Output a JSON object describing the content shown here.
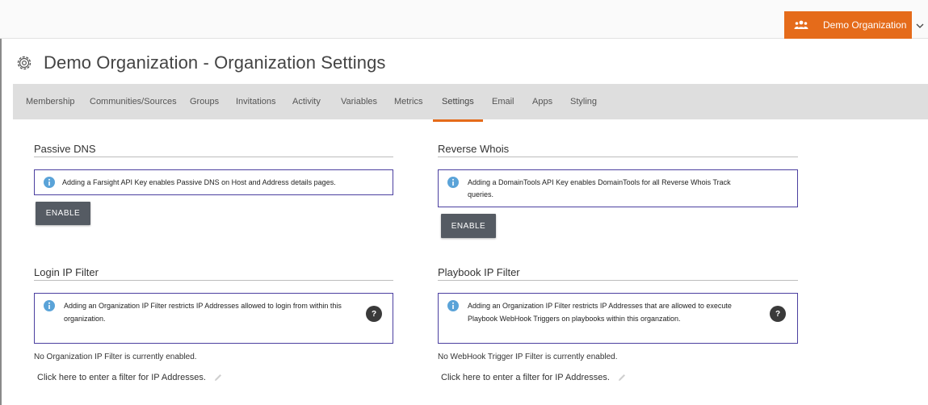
{
  "header": {
    "org_label": "Demo Organization",
    "org_icon": "people-icon",
    "dropdown_icon": "chevron-down-icon",
    "accent": "#e56b1a"
  },
  "page": {
    "title": "Demo Organization - Organization Settings",
    "title_icon": "gear-icon"
  },
  "tabs": [
    {
      "label": "Membership"
    },
    {
      "label": "Communities/Sources"
    },
    {
      "label": "Groups"
    },
    {
      "label": "Invitations"
    },
    {
      "label": "Activity"
    },
    {
      "label": "Variables"
    },
    {
      "label": "Metrics"
    },
    {
      "label": "Settings",
      "active": true
    },
    {
      "label": "Email"
    },
    {
      "label": "Apps"
    },
    {
      "label": "Styling"
    }
  ],
  "passive_dns": {
    "title": "Passive DNS",
    "info": "Adding a Farsight API Key enables Passive DNS on Host and Address details pages.",
    "button": "ENABLE"
  },
  "reverse_whois": {
    "title": "Reverse Whois",
    "info_line1": "Adding a DomainTools API Key enables DomainTools for all Reverse Whois Track",
    "info_line2": "queries.",
    "button": "ENABLE"
  },
  "login_ip": {
    "title": "Login IP Filter",
    "info_line1": "Adding an Organization IP Filter restricts IP Addresses allowed to login from within this",
    "info_line2": "organization.",
    "help": "?",
    "status": "No Organization IP Filter is currently enabled.",
    "link": "Click here to enter a filter for IP Addresses."
  },
  "playbook_ip": {
    "title": "Playbook IP Filter",
    "info_line1": "Adding an Organization IP Filter restricts IP Addresses that are allowed to execute",
    "info_line2": "Playbook WebHook Triggers on playbooks within this organzation.",
    "help": "?",
    "status": "No WebHook Trigger IP Filter is currently enabled.",
    "link": "Click here to enter a filter for IP Addresses."
  },
  "colors": {
    "info_border": "#4b3fa0",
    "info_icon": "#5aa3d8",
    "button_bg": "#555b63",
    "tab_bar": "#dedede"
  }
}
